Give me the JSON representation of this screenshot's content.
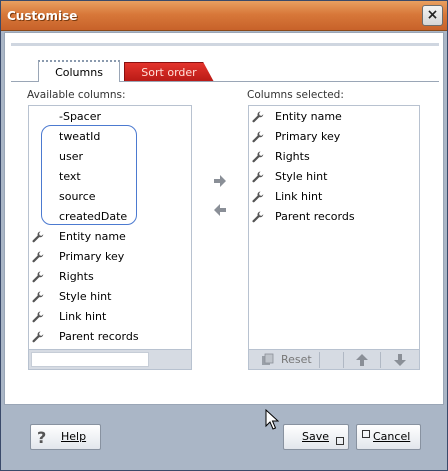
{
  "window": {
    "title": "Customise",
    "close_glyph": "×"
  },
  "tabs": [
    {
      "label": "Columns",
      "active": true
    },
    {
      "label": "Sort order",
      "active": false
    }
  ],
  "available": {
    "label": "Available columns:",
    "spacer": "-Spacer",
    "plain_items": [
      "tweatId",
      "user",
      "text",
      "source",
      "createdDate"
    ],
    "icon_items": [
      "Entity name",
      "Primary key",
      "Rights",
      "Style hint",
      "Link hint",
      "Parent records"
    ],
    "filter_value": ""
  },
  "selected": {
    "label": "Columns selected:",
    "items": [
      "Entity name",
      "Primary key",
      "Rights",
      "Style hint",
      "Link hint",
      "Parent records"
    ],
    "reset_label": "Reset"
  },
  "buttons": {
    "help": "Help",
    "save": "Save",
    "cancel": "Cancel"
  },
  "icons": {
    "row_icon": "wrench-icon",
    "add": "arrow-right-icon",
    "remove": "arrow-left-icon",
    "reset": "reset-icon",
    "up": "arrow-up-icon",
    "down": "arrow-down-icon",
    "help": "help-icon"
  },
  "colors": {
    "titlebar": "#d8783a",
    "active_tab_border": "#9aa6b6",
    "inactive_tab": "#c8231e",
    "highlight": "#4c7ad0"
  }
}
